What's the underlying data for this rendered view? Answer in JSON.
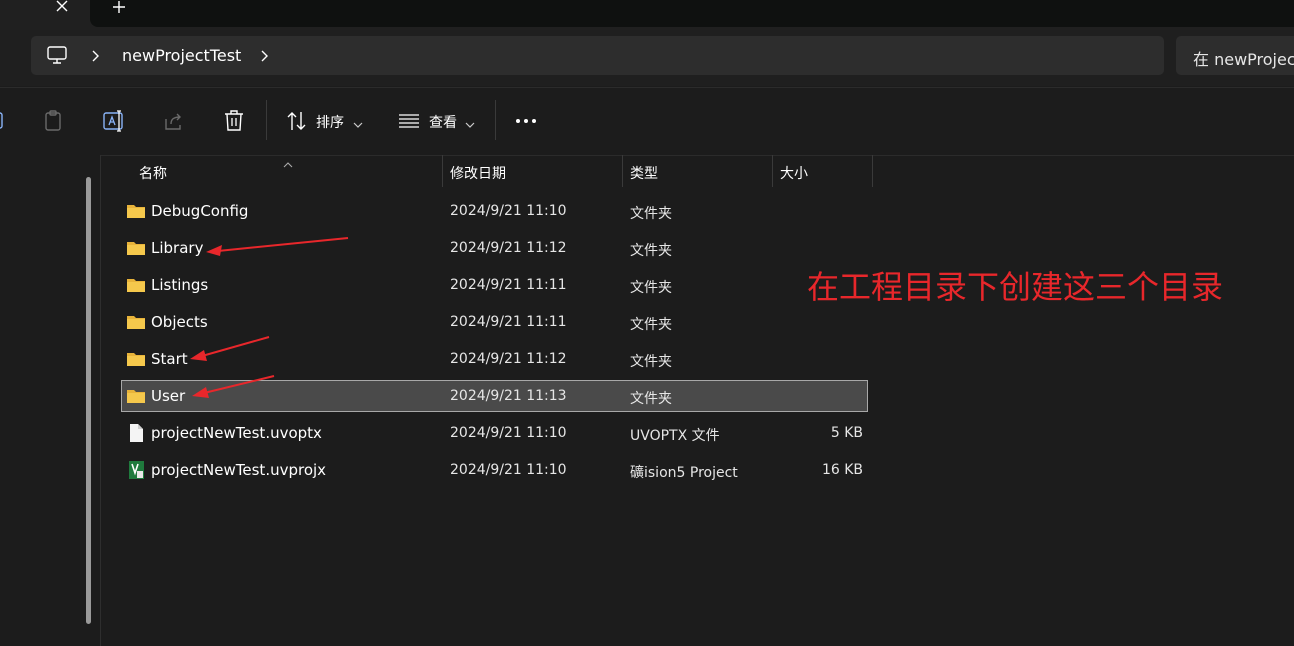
{
  "breadcrumb": {
    "folder": "newProjectTest"
  },
  "search": {
    "text": "在 newProjec"
  },
  "toolbar": {
    "sort_label": "排序",
    "view_label": "查看"
  },
  "columns": {
    "name": "名称",
    "date": "修改日期",
    "type": "类型",
    "size": "大小"
  },
  "files": [
    {
      "name": "DebugConfig",
      "date": "2024/9/21 11:10",
      "type": "文件夹",
      "size": "",
      "icon": "folder-icon"
    },
    {
      "name": "Library",
      "date": "2024/9/21 11:12",
      "type": "文件夹",
      "size": "",
      "icon": "folder-icon"
    },
    {
      "name": "Listings",
      "date": "2024/9/21 11:11",
      "type": "文件夹",
      "size": "",
      "icon": "folder-icon"
    },
    {
      "name": "Objects",
      "date": "2024/9/21 11:11",
      "type": "文件夹",
      "size": "",
      "icon": "folder-icon"
    },
    {
      "name": "Start",
      "date": "2024/9/21 11:12",
      "type": "文件夹",
      "size": "",
      "icon": "folder-icon"
    },
    {
      "name": "User",
      "date": "2024/9/21 11:13",
      "type": "文件夹",
      "size": "",
      "icon": "folder-icon",
      "selected": true
    },
    {
      "name": "projectNewTest.uvoptx",
      "date": "2024/9/21 11:10",
      "type": "UVOPTX 文件",
      "size": "5 KB",
      "icon": "file-icon"
    },
    {
      "name": "projectNewTest.uvprojx",
      "date": "2024/9/21 11:10",
      "type": "礦ision5 Project",
      "size": "16 KB",
      "icon": "uvision-project-icon"
    }
  ],
  "annotation": {
    "text": "在工程目录下创建这三个目录",
    "color": "#e8272b"
  },
  "colors": {
    "background": "#1c1c1c",
    "folder": "#f2c14e",
    "arrow": "#e8272b"
  }
}
